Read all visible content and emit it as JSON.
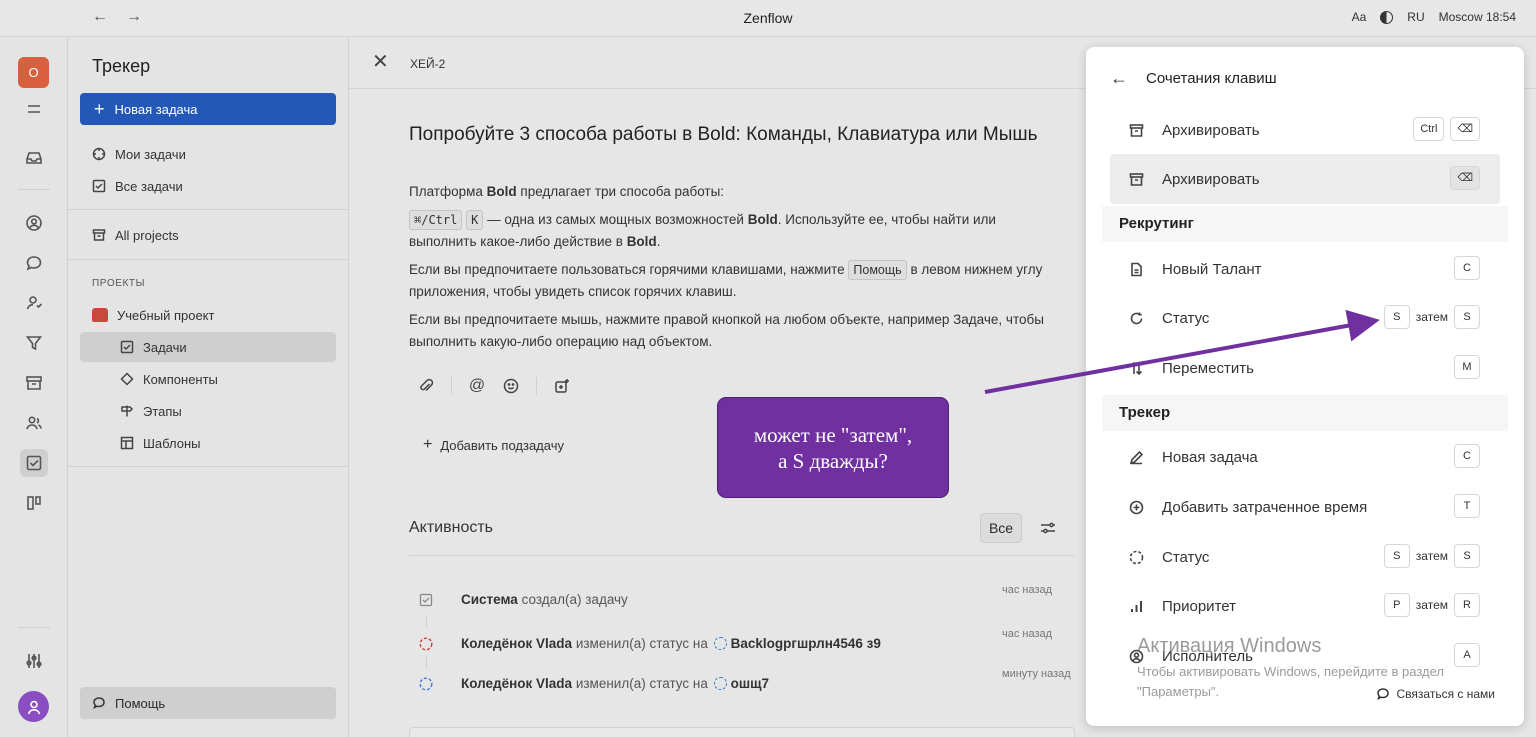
{
  "titlebar": {
    "back": "←",
    "forward": "→",
    "app_title": "Zenflow",
    "font_size": "Aa",
    "lang": "RU",
    "clock": "Moscow 18:54"
  },
  "rail": {
    "workspace_initial": "O"
  },
  "sidebar": {
    "title": "Трекер",
    "new_task": "Новая задача",
    "my_tasks": "Мои задачи",
    "all_tasks": "Все задачи",
    "all_projects": "All projects",
    "section": "ПРОЕКТЫ",
    "project": "Учебный проект",
    "sub_items": [
      "Задачи",
      "Компоненты",
      "Этапы",
      "Шаблоны"
    ],
    "help": "Помощь"
  },
  "task": {
    "id": "ХЕЙ-2",
    "title": "Попробуйте 3 способа работы в Bold: Команды, Клавиатура или Мышь",
    "p1_a": "Платформа ",
    "p1_bold": "Bold",
    "p1_b": " предлагает три способа работы:",
    "p2_kbd1": "⌘/Ctrl",
    "p2_kbd2": "K",
    "p2_a": " — одна из самых мощных возможностей ",
    "p2_bold": "Bold",
    "p2_b": ". Используйте ее, чтобы найти или выполнить какое-либо действие в ",
    "p2_bold2": "Bold",
    "p2_c": ".",
    "p3_a": "Если вы предпочитаете пользоваться горячими клавишами, нажмите ",
    "p3_kbd": "Помощь",
    "p3_b": " в левом нижнем углу приложения, чтобы увидеть список горячих клавиш.",
    "p4": "Если вы предпочитаете мышь, нажмите правой кнопкой на любом объекте, например Задаче, чтобы выполнить какую-либо операцию над объектом.",
    "add_subtask": "Добавить подзадачу"
  },
  "activity": {
    "title": "Активность",
    "filter_all": "Все",
    "rows": [
      {
        "actor": "Система",
        "action": " создал(а) задачу",
        "status": "",
        "time": "час назад"
      },
      {
        "actor": "Коледёнок Vlada",
        "action": " изменил(а) статус на ",
        "status": "Backlogргшрлн4546 з9",
        "time": "час назад"
      },
      {
        "actor": "Коледёнок Vlada",
        "action": " изменил(а) статус на ",
        "status": "ошщ7",
        "time": "минуту назад"
      }
    ]
  },
  "shortcuts": {
    "title": "Сочетания клавиш",
    "rows": [
      {
        "label": "Архивировать",
        "keys": [
          "Ctrl",
          "⌫"
        ],
        "icon": "archive-icon"
      },
      {
        "label": "Архивировать",
        "keys": [
          "⌫"
        ],
        "icon": "archive-icon"
      }
    ],
    "groups": [
      {
        "title": "Рекрутинг",
        "rows": [
          {
            "label": "Новый Талант",
            "keys": [
              "C"
            ],
            "then": "",
            "icon": "file-icon"
          },
          {
            "label": "Статус",
            "keys": [
              "S",
              "S"
            ],
            "then": "затем",
            "icon": "status-icon"
          },
          {
            "label": "Переместить",
            "keys": [
              "M"
            ],
            "then": "",
            "icon": "move-icon"
          }
        ]
      },
      {
        "title": "Трекер",
        "rows": [
          {
            "label": "Новая задача",
            "keys": [
              "C"
            ],
            "then": "",
            "icon": "pencil-icon"
          },
          {
            "label": "Добавить затраченное время",
            "keys": [
              "T"
            ],
            "then": "",
            "icon": "plus-circle-icon"
          },
          {
            "label": "Статус",
            "keys": [
              "S",
              "S"
            ],
            "then": "затем",
            "icon": "status-dashed-icon"
          },
          {
            "label": "Приоритет",
            "keys": [
              "P",
              "R"
            ],
            "then": "затем",
            "icon": "priority-icon"
          },
          {
            "label": "Исполнитель",
            "keys": [
              "A"
            ],
            "then": "",
            "icon": "user-circle-icon"
          }
        ]
      }
    ],
    "contact": "Связаться с нами"
  },
  "watermark": {
    "title": "Активация Windows",
    "text": "Чтобы активировать Windows, перейдите в раздел \"Параметры\"."
  },
  "annotation": {
    "line1": "может не \"затем\",",
    "line2": "а S дважды?",
    "color": "#7030a0"
  }
}
